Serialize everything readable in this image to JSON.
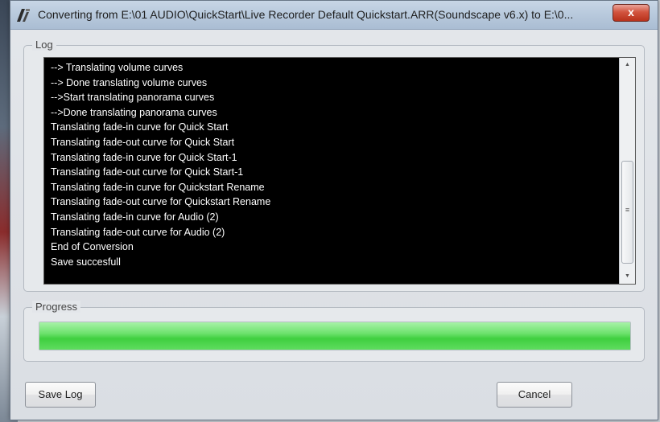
{
  "window": {
    "title": "Converting from E:\\01 AUDIO\\QuickStart\\Live Recorder Default Quickstart.ARR(Soundscape v6.x) to E:\\0...",
    "close_label": "x"
  },
  "log": {
    "legend": "Log",
    "lines": [
      "--> Translating volume curves",
      "--> Done translating volume curves",
      "-->Start translating panorama curves",
      "-->Done translating panorama curves",
      "Translating fade-in curve for Quick Start",
      "Translating fade-out curve for Quick Start",
      "Translating fade-in curve for Quick Start-1",
      "Translating fade-out curve for Quick Start-1",
      "Translating fade-in curve for Quickstart Rename",
      "Translating fade-out curve for Quickstart Rename",
      "Translating fade-in curve for Audio (2)",
      "Translating fade-out curve for Audio (2)",
      "End of Conversion",
      "Save succesfull"
    ]
  },
  "progress": {
    "legend": "Progress",
    "value_fraction": 1.0,
    "fill_color": "#4cd64c"
  },
  "buttons": {
    "save_log": "Save Log",
    "cancel": "Cancel"
  }
}
